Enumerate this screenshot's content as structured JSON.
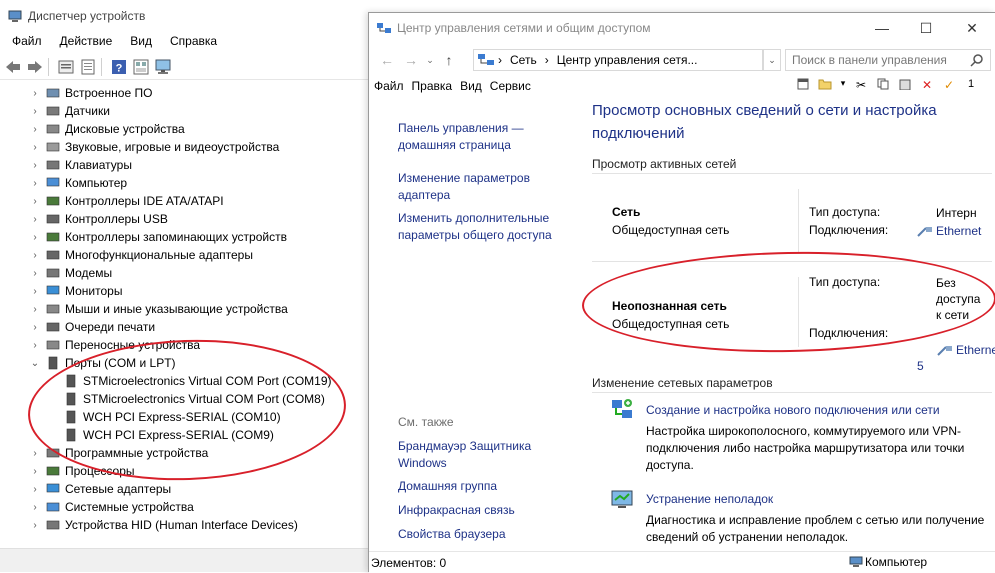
{
  "device_manager": {
    "title": "Диспетчер устройств",
    "menu": [
      "Файл",
      "Действие",
      "Вид",
      "Справка"
    ],
    "toolbar_icons": [
      "back-icon",
      "forward-icon",
      "properties-icon",
      "update-icon",
      "help-icon",
      "view-icon",
      "monitor-icon"
    ],
    "tree": [
      {
        "label": "Встроенное ПО",
        "icon": "firmware-icon"
      },
      {
        "label": "Датчики",
        "icon": "sensor-icon"
      },
      {
        "label": "Дисковые устройства",
        "icon": "disk-icon"
      },
      {
        "label": "Звуковые, игровые и видеоустройства",
        "icon": "sound-icon"
      },
      {
        "label": "Клавиатуры",
        "icon": "keyboard-icon"
      },
      {
        "label": "Компьютер",
        "icon": "computer-icon"
      },
      {
        "label": "Контроллеры IDE ATA/ATAPI",
        "icon": "ide-icon"
      },
      {
        "label": "Контроллеры USB",
        "icon": "usb-icon"
      },
      {
        "label": "Контроллеры запоминающих устройств",
        "icon": "storage-icon"
      },
      {
        "label": "Многофункциональные адаптеры",
        "icon": "multifunction-icon"
      },
      {
        "label": "Модемы",
        "icon": "modem-icon"
      },
      {
        "label": "Мониторы",
        "icon": "monitor-icon"
      },
      {
        "label": "Мыши и иные указывающие устройства",
        "icon": "mouse-icon"
      },
      {
        "label": "Очереди печати",
        "icon": "printer-icon"
      },
      {
        "label": "Переносные устройства",
        "icon": "portable-icon"
      },
      {
        "label": "Порты (COM и LPT)",
        "icon": "port-icon",
        "expanded": true
      },
      {
        "label": "STMicroelectronics Virtual COM Port (COM19)",
        "icon": "port-icon",
        "child": true
      },
      {
        "label": "STMicroelectronics Virtual COM Port (COM8)",
        "icon": "port-icon",
        "child": true
      },
      {
        "label": "WCH PCI Express-SERIAL (COM10)",
        "icon": "port-icon",
        "child": true
      },
      {
        "label": "WCH PCI Express-SERIAL (COM9)",
        "icon": "port-icon",
        "child": true
      },
      {
        "label": "Программные устройства",
        "icon": "software-icon"
      },
      {
        "label": "Процессоры",
        "icon": "cpu-icon"
      },
      {
        "label": "Сетевые адаптеры",
        "icon": "network-adapter-icon"
      },
      {
        "label": "Системные устройства",
        "icon": "system-icon"
      },
      {
        "label": "Устройства HID (Human Interface Devices)",
        "icon": "hid-icon"
      }
    ]
  },
  "network_center": {
    "title": "Центр управления сетями и общим доступом",
    "window_controls": {
      "minimize": "—",
      "maximize": "☐",
      "close": "✕"
    },
    "address": {
      "segments": [
        "Сеть",
        "Центр управления сетя..."
      ],
      "separator": "›"
    },
    "search_placeholder": "Поиск в панели управления",
    "menu": [
      "Файл",
      "Правка",
      "Вид",
      "Сервис"
    ],
    "toolbar_count": "1",
    "left_links": [
      "Панель управления —\nдомашняя страница",
      "Изменение параметров\nадаптера",
      "Изменить дополнительные\nпараметры общего доступа"
    ],
    "see_also_label": "См. также",
    "see_also": [
      "Брандмауэр Защитника\nWindows",
      "Домашняя группа",
      "Инфракрасная связь",
      "Свойства браузера"
    ],
    "main_title": "Просмотр основных сведений о сети и настройка подключений",
    "active_networks_header": "Просмотр активных сетей",
    "networks": [
      {
        "name": "Сеть",
        "type": "Общедоступная сеть",
        "access_label": "Тип доступа:",
        "access_value": "Интерн",
        "conn_label": "Подключения:",
        "conn_value": "Ethernet"
      },
      {
        "name": "Неопознанная сеть",
        "type": "Общедоступная сеть",
        "access_label": "Тип доступа:",
        "access_value": "Без\nдоступа\nк сети",
        "conn_label": "Подключения:",
        "conn_value": "Ethernet\n5"
      }
    ],
    "change_settings_header": "Изменение сетевых параметров",
    "tasks": [
      {
        "link": "Создание и настройка нового подключения или сети",
        "desc": "Настройка широкополосного, коммутируемого или VPN-подключения либо настройка маршрутизатора или точки доступа.",
        "icon": "new-connection-icon"
      },
      {
        "link": "Устранение неполадок",
        "desc": "Диагностика и исправление проблем с сетью или получение сведений об устранении неполадок.",
        "icon": "troubleshoot-icon"
      }
    ],
    "status": {
      "items": "Элементов: 0",
      "location": "Компьютер"
    }
  },
  "colors": {
    "link": "#1e3287",
    "annotation": "#d8202a"
  }
}
